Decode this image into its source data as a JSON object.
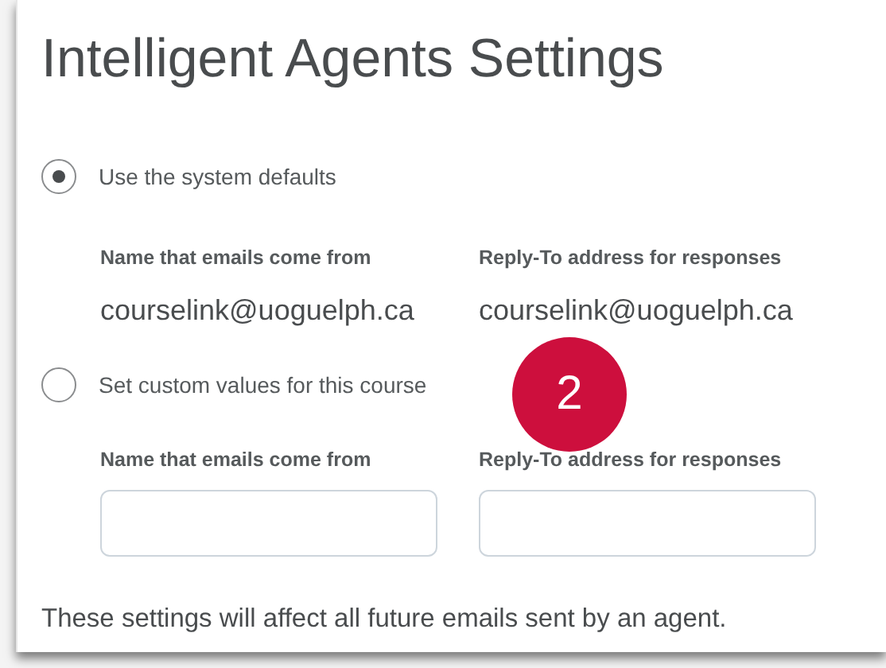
{
  "title": "Intelligent Agents Settings",
  "options": [
    {
      "label": "Use the system defaults",
      "selected": true,
      "kind": "values",
      "fields": [
        {
          "label": "Name that emails come from",
          "value": "courselink@uoguelph.ca"
        },
        {
          "label": "Reply-To address for responses",
          "value": "courselink@uoguelph.ca"
        }
      ]
    },
    {
      "label": "Set custom values for this course",
      "selected": false,
      "kind": "inputs",
      "fields": [
        {
          "label": "Name that emails come from"
        },
        {
          "label": "Reply-To address for responses"
        }
      ]
    }
  ],
  "badge": "2",
  "footer": "These settings will affect all future emails sent by an agent."
}
